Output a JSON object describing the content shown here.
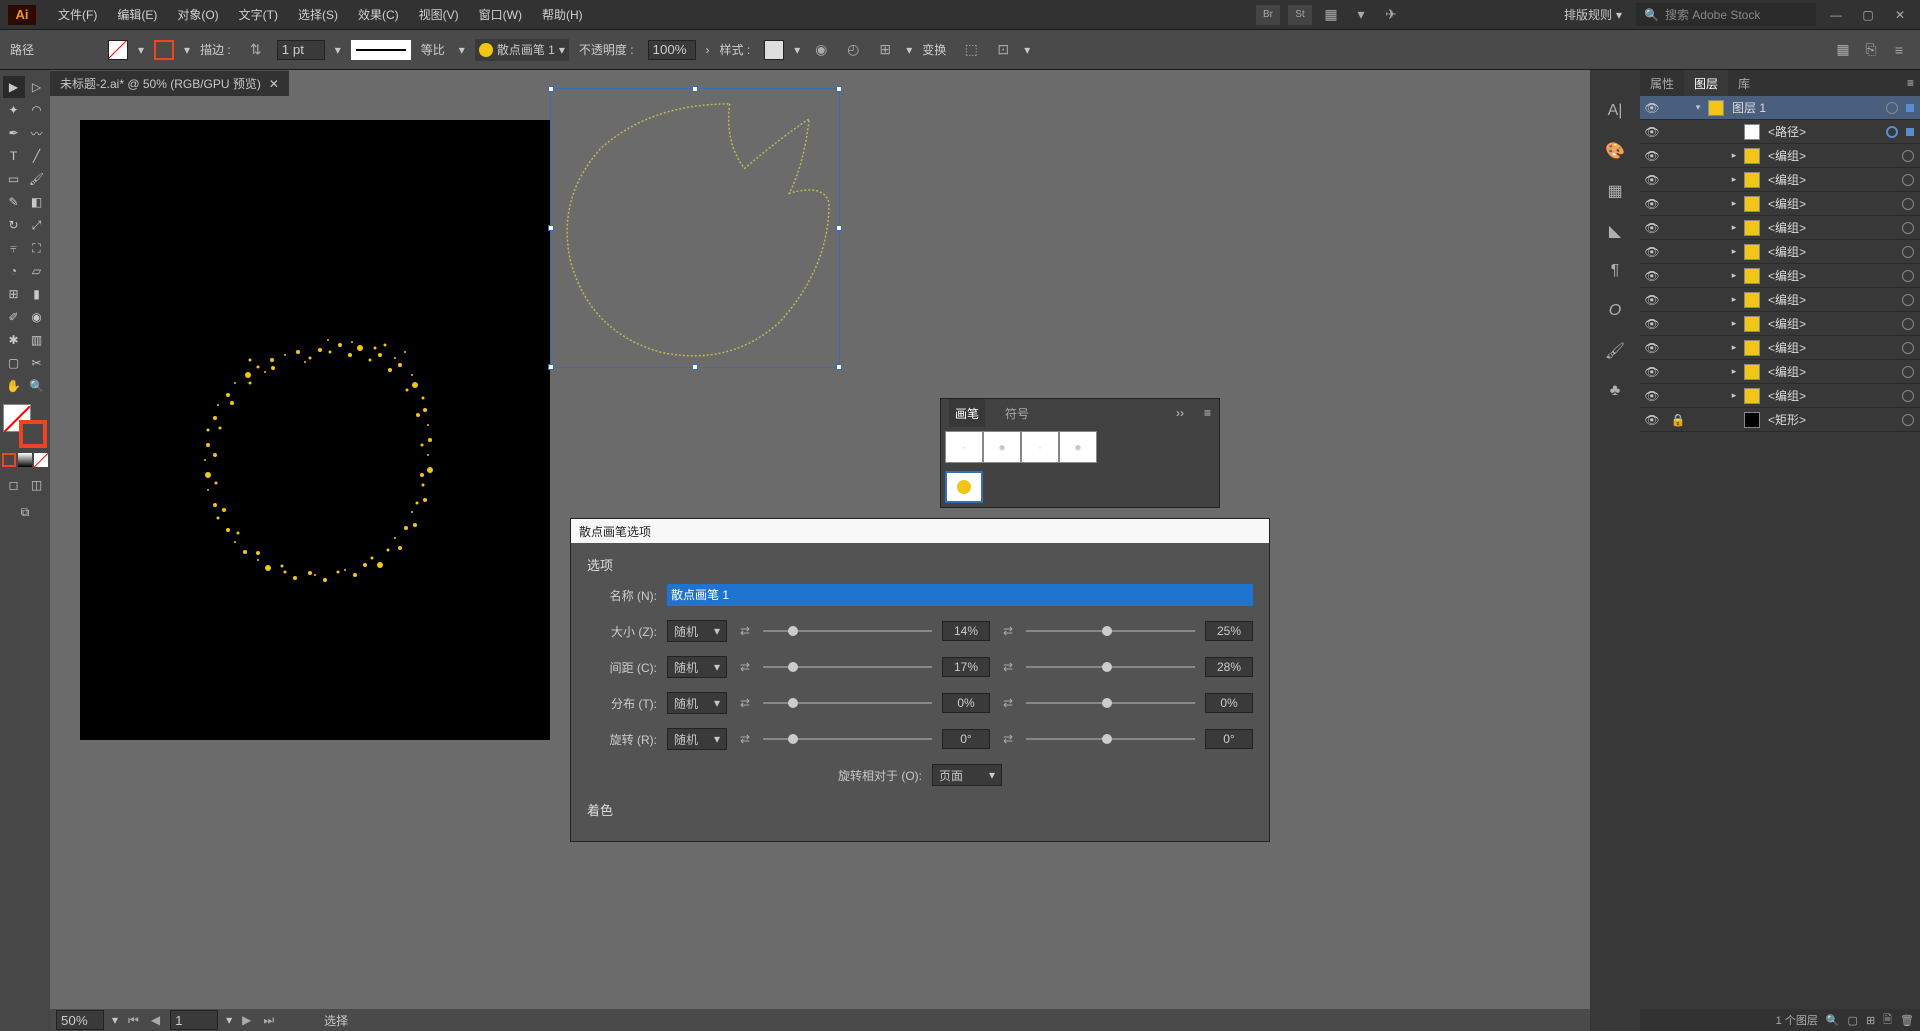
{
  "menubar": {
    "items": [
      "文件(F)",
      "编辑(E)",
      "对象(O)",
      "文字(T)",
      "选择(S)",
      "效果(C)",
      "视图(V)",
      "窗口(W)",
      "帮助(H)"
    ],
    "right_icons": [
      "Br",
      "St"
    ],
    "layout_label": "排版规则",
    "search_placeholder": "搜索 Adobe Stock"
  },
  "controlbar": {
    "selection_label": "路径",
    "stroke_label": "描边 :",
    "stroke_weight": "1 pt",
    "proportions": "等比",
    "brush_name": "散点画笔 1",
    "opacity_label": "不透明度 :",
    "opacity": "100%",
    "style_label": "样式 :",
    "transform_label": "变换"
  },
  "doc_tab": "未标题-2.ai* @ 50% (RGB/GPU 预览)",
  "statusbar": {
    "zoom": "50%",
    "page": "1",
    "select_label": "选择"
  },
  "panel_tabs": [
    "属性",
    "图层",
    "库"
  ],
  "layers": [
    {
      "name": "图层 1",
      "top": true,
      "thumb": "yellow",
      "disclose": "v",
      "selected": true
    },
    {
      "name": "<路径>",
      "thumb": "white",
      "indent": 2,
      "target_sel": true,
      "sel_sq": true
    },
    {
      "name": "<编组>",
      "thumb": "yellow",
      "indent": 2,
      "disclose": ">"
    },
    {
      "name": "<编组>",
      "thumb": "yellow",
      "indent": 2,
      "disclose": ">"
    },
    {
      "name": "<编组>",
      "thumb": "yellow",
      "indent": 2,
      "disclose": ">"
    },
    {
      "name": "<编组>",
      "thumb": "yellow",
      "indent": 2,
      "disclose": ">"
    },
    {
      "name": "<编组>",
      "thumb": "yellow",
      "indent": 2,
      "disclose": ">"
    },
    {
      "name": "<编组>",
      "thumb": "yellow",
      "indent": 2,
      "disclose": ">"
    },
    {
      "name": "<编组>",
      "thumb": "yellow",
      "indent": 2,
      "disclose": ">"
    },
    {
      "name": "<编组>",
      "thumb": "yellow",
      "indent": 2,
      "disclose": ">"
    },
    {
      "name": "<编组>",
      "thumb": "yellow",
      "indent": 2,
      "disclose": ">"
    },
    {
      "name": "<编组>",
      "thumb": "yellow",
      "indent": 2,
      "disclose": ">"
    },
    {
      "name": "<编组>",
      "thumb": "yellow",
      "indent": 2,
      "disclose": ">"
    },
    {
      "name": "<矩形>",
      "thumb": "black",
      "indent": 2,
      "locked": true
    }
  ],
  "layers_footer": "1 个图层",
  "brushes_panel": {
    "tabs": [
      "画笔",
      "符号"
    ]
  },
  "options_dialog": {
    "title": "散点画笔选项",
    "section_options": "选项",
    "name_label": "名称 (N):",
    "name_value": "散点画笔 1",
    "rows": [
      {
        "label": "大小 (Z):",
        "mode": "随机",
        "v1": "14%",
        "v2": "25%"
      },
      {
        "label": "间距 (C):",
        "mode": "随机",
        "v1": "17%",
        "v2": "28%"
      },
      {
        "label": "分布 (T):",
        "mode": "随机",
        "v1": "0%",
        "v2": "0%"
      },
      {
        "label": "旋转 (R):",
        "mode": "随机",
        "v1": "0°",
        "v2": "0°"
      }
    ],
    "rotate_rel_label": "旋转相对于 (O):",
    "rotate_rel_value": "页面",
    "section_color": "着色"
  }
}
